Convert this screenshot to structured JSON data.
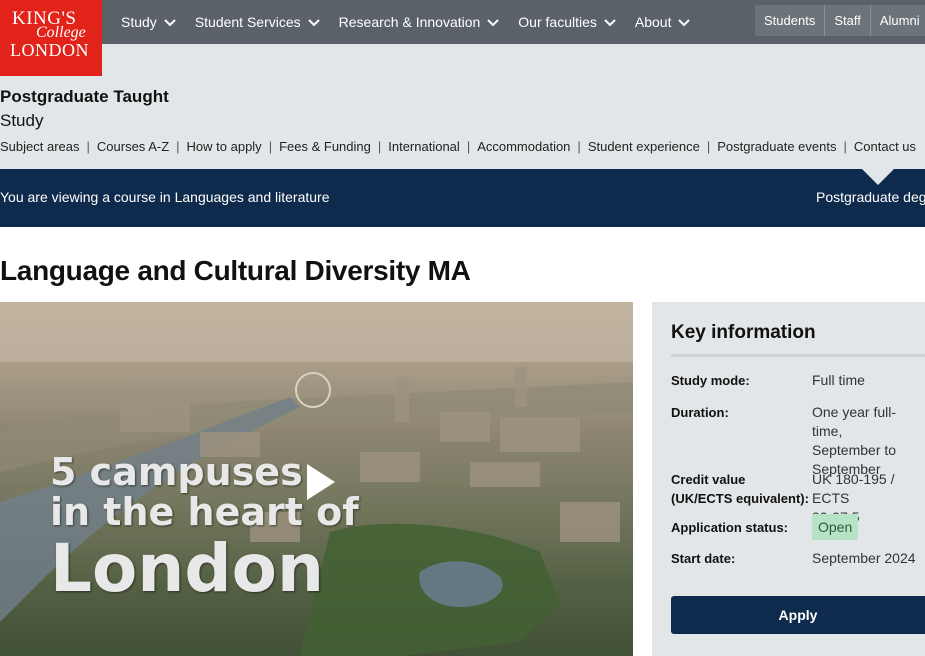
{
  "logo": {
    "line1": "KING'S",
    "line2": "College",
    "line3": "LONDON"
  },
  "nav": {
    "items": [
      {
        "label": "Study"
      },
      {
        "label": "Student Services"
      },
      {
        "label": "Research & Innovation"
      },
      {
        "label": "Our faculties"
      },
      {
        "label": "About"
      }
    ],
    "audience": [
      "Students",
      "Staff",
      "Alumni"
    ]
  },
  "section": {
    "title": "Postgraduate Taught",
    "subtitle": "Study"
  },
  "subnav": [
    "Subject areas",
    "Courses A-Z",
    "How to apply",
    "Fees & Funding",
    "International",
    "Accommodation",
    "Student experience",
    "Postgraduate events",
    "Contact us"
  ],
  "banner": {
    "left": "You are viewing a course in Languages and literature",
    "right": "Postgraduate degr"
  },
  "page_title": "Language and Cultural Diversity MA",
  "video": {
    "caption_line1": "5 campuses",
    "caption_line2": "in the heart of",
    "caption_line3": "London"
  },
  "key_info": {
    "title": "Key information",
    "rows": [
      {
        "label": "Study mode:",
        "value": "Full time"
      },
      {
        "label": "Duration:",
        "value_lines": [
          "One year full-time,",
          "September to",
          "September"
        ]
      },
      {
        "label_lines": [
          "Credit value",
          "(UK/ECTS equivalent):"
        ],
        "value_lines": [
          "UK 180-195 / ECTS",
          "90-97.5"
        ]
      },
      {
        "label": "Application status:",
        "value": "Open"
      },
      {
        "label": "Start date:",
        "value": "September 2024"
      }
    ],
    "apply_label": "Apply"
  },
  "colors": {
    "nav_bg": "#5a6168",
    "brand_red": "#e2231a",
    "navy": "#0e2a4c",
    "light_grey": "#e3e6e8",
    "status_green": "#b6e3c6"
  }
}
